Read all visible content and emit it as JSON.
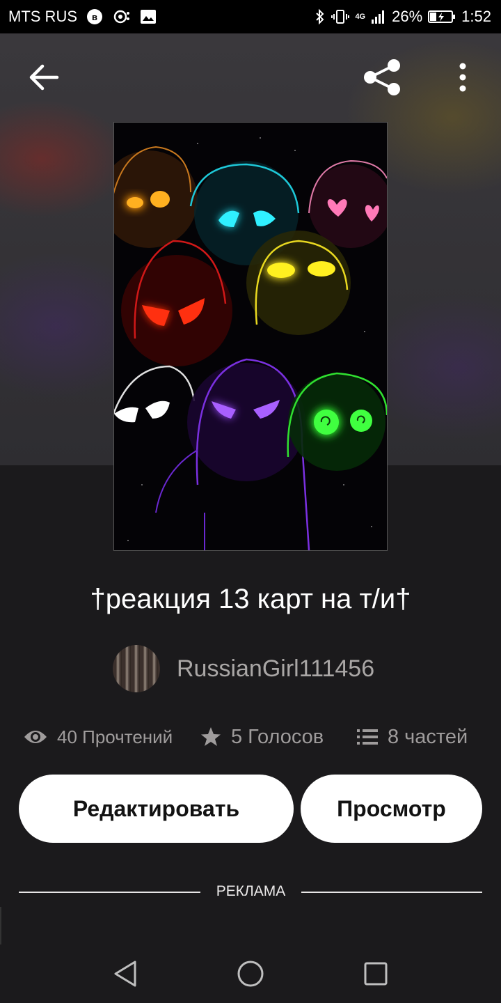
{
  "status_bar": {
    "carrier": "MTS RUS",
    "vk_badge": "в",
    "network": "4G",
    "battery": "26%",
    "time": "1:52"
  },
  "icons": {
    "back": "arrow-left-icon",
    "share": "share-icon",
    "more": "more-vertical-icon",
    "reads": "eye-icon",
    "votes": "star-icon",
    "parts": "list-icon"
  },
  "story": {
    "title": "†реакция 13 карт на т/и†",
    "author": "RussianGirl111456",
    "reads": "40 Прочтений",
    "votes": "5 Голосов",
    "parts": "8 частей"
  },
  "actions": {
    "edit_label": "Редактировать",
    "preview_label": "Просмотр"
  },
  "ad": {
    "label": "РЕКЛАМА"
  },
  "colors": {
    "background": "#1b1a1c",
    "button_bg": "#ffffff",
    "muted_text": "#9f9c9c"
  }
}
